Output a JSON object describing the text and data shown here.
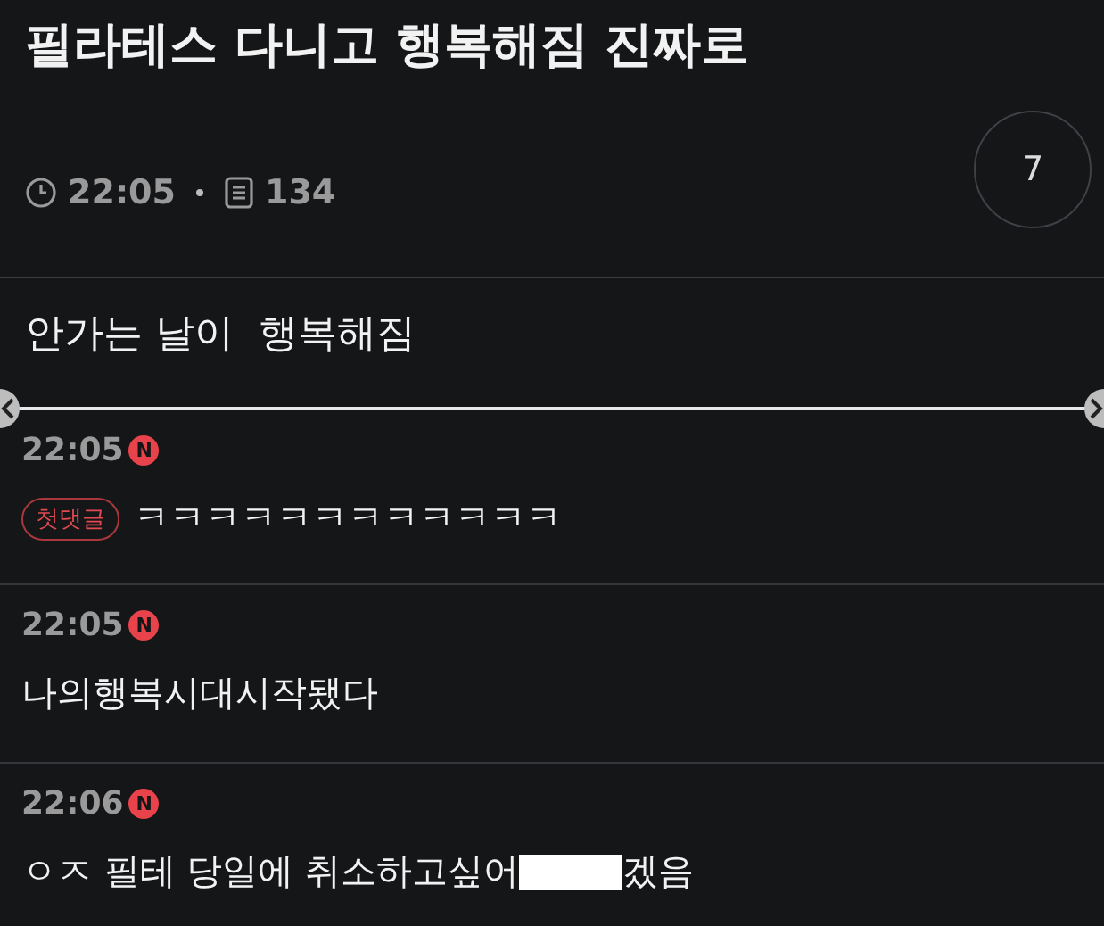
{
  "post": {
    "title": "필라테스 다니고 행복해짐 진짜로",
    "time": "22:05",
    "count": "134",
    "comment_count": "7",
    "body": "안가는 날이  행복해짐"
  },
  "slider": {
    "prev": true,
    "next": true
  },
  "comments": [
    {
      "time": "22:05",
      "new_badge": "N",
      "tag": "첫댓글",
      "parts": [
        {
          "kind": "text",
          "text": "ㅋㅋㅋㅋㅋㅋㅋㅋㅋㅋㅋㅋ"
        }
      ]
    },
    {
      "time": "22:05",
      "new_badge": "N",
      "parts": [
        {
          "kind": "text",
          "text": "나의행복시대시작됐다"
        }
      ]
    },
    {
      "time": "22:06",
      "new_badge": "N",
      "parts": [
        {
          "kind": "text",
          "text": "ㅇㅈ 필테 당일에 취소하고싶어"
        },
        {
          "kind": "redacted"
        },
        {
          "kind": "text",
          "text": "겠음"
        }
      ]
    }
  ]
}
